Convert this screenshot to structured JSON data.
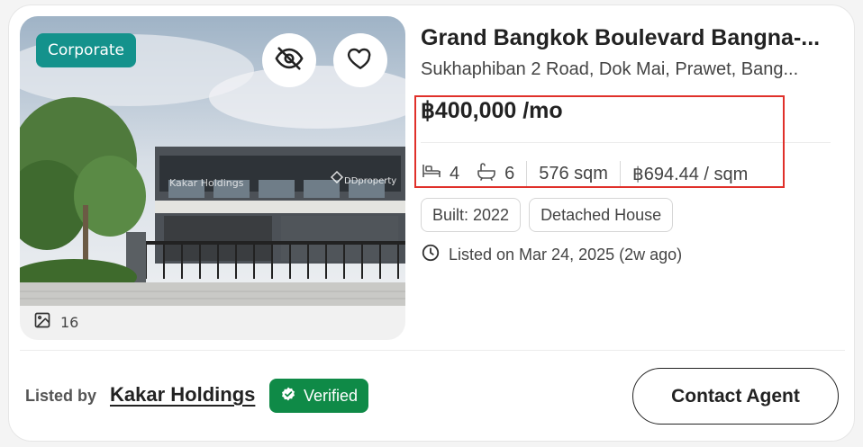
{
  "listing": {
    "badge": "Corporate",
    "photo_count": "16",
    "photo_watermark_agent": "Kakar Holdings",
    "photo_watermark_brand": "DDproperty",
    "title": "Grand Bangkok Boulevard Bangna-...",
    "address": "Sukhaphiban 2 Road, Dok Mai, Prawet, Bang...",
    "price": "฿400,000 /mo",
    "bedrooms": "4",
    "bathrooms": "6",
    "area": "576 sqm",
    "price_per_sqm": "฿694.44 / sqm",
    "tags": [
      "Built: 2022",
      "Detached House"
    ],
    "listed_date": "Listed on Mar 24, 2025 (2w ago)"
  },
  "footer": {
    "listed_by_label": "Listed by",
    "agent_name": "Kakar Holdings",
    "verified_label": "Verified",
    "contact_label": "Contact Agent"
  },
  "colors": {
    "badge_bg": "#14928c",
    "verified_bg": "#0f8a47",
    "highlight_border": "#e0302a"
  },
  "icons": {
    "hide": "eye-off-icon",
    "favorite": "heart-icon",
    "photos": "image-icon",
    "bed": "bed-icon",
    "bath": "bathtub-icon",
    "clock": "clock-icon",
    "verified": "verified-check-icon"
  }
}
